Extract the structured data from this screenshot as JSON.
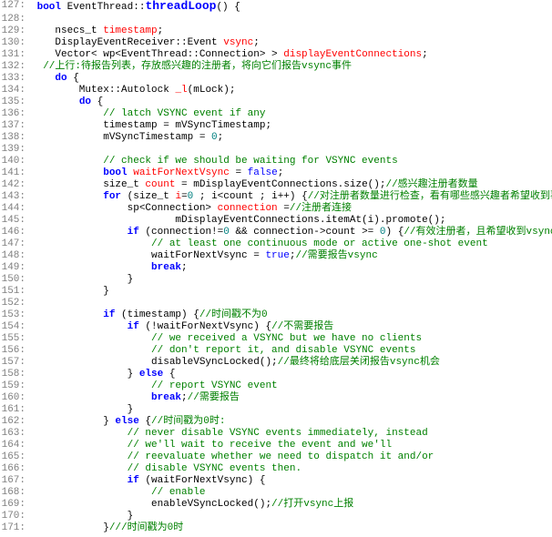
{
  "lines": [
    {
      "n": "127:",
      "segs": [
        {
          "c": "bk",
          "t": " "
        },
        {
          "c": "kw",
          "t": "bool"
        },
        {
          "c": "bk",
          "t": " EventThread::"
        },
        {
          "c": "bl big",
          "t": "threadLoop"
        },
        {
          "c": "bk",
          "t": "() {"
        }
      ]
    },
    {
      "n": "128:",
      "segs": []
    },
    {
      "n": "129:",
      "segs": [
        {
          "c": "bk",
          "t": "    nsecs_t "
        },
        {
          "c": "red",
          "t": "timestamp"
        },
        {
          "c": "bk",
          "t": ";"
        }
      ]
    },
    {
      "n": "130:",
      "segs": [
        {
          "c": "bk",
          "t": "    DisplayEventReceiver::Event "
        },
        {
          "c": "red",
          "t": "vsync"
        },
        {
          "c": "bk",
          "t": ";"
        }
      ]
    },
    {
      "n": "131:",
      "segs": [
        {
          "c": "bk",
          "t": "    Vector< wp<EventThread::Connection> > "
        },
        {
          "c": "red",
          "t": "displayEventConnections"
        },
        {
          "c": "bk",
          "t": ";"
        }
      ]
    },
    {
      "n": "132:",
      "segs": [
        {
          "c": "gr",
          "t": "  //上行:待报告列表，存放感兴趣的注册者，将向它们报告vsync事件"
        }
      ]
    },
    {
      "n": "133:",
      "segs": [
        {
          "c": "bk",
          "t": "    "
        },
        {
          "c": "kw",
          "t": "do"
        },
        {
          "c": "bk",
          "t": " {"
        }
      ]
    },
    {
      "n": "134:",
      "segs": [
        {
          "c": "bk",
          "t": "        Mutex::Autolock "
        },
        {
          "c": "red",
          "t": "_l"
        },
        {
          "c": "bk",
          "t": "(mLock);"
        }
      ]
    },
    {
      "n": "135:",
      "segs": [
        {
          "c": "bk",
          "t": "        "
        },
        {
          "c": "kw",
          "t": "do"
        },
        {
          "c": "bk",
          "t": " {"
        }
      ]
    },
    {
      "n": "136:",
      "segs": [
        {
          "c": "gr",
          "t": "            // latch VSYNC event if any"
        }
      ]
    },
    {
      "n": "137:",
      "segs": [
        {
          "c": "bk",
          "t": "            timestamp = mVSyncTimestamp;"
        }
      ]
    },
    {
      "n": "138:",
      "segs": [
        {
          "c": "bk",
          "t": "            mVSyncTimestamp = "
        },
        {
          "c": "cm",
          "t": "0"
        },
        {
          "c": "bk",
          "t": ";"
        }
      ]
    },
    {
      "n": "139:",
      "segs": []
    },
    {
      "n": "140:",
      "segs": [
        {
          "c": "gr",
          "t": "            // check if we should be waiting for VSYNC events"
        }
      ]
    },
    {
      "n": "141:",
      "segs": [
        {
          "c": "bk",
          "t": "            "
        },
        {
          "c": "kw",
          "t": "bool"
        },
        {
          "c": "bk",
          "t": " "
        },
        {
          "c": "red",
          "t": "waitForNextVsync"
        },
        {
          "c": "bk",
          "t": " = "
        },
        {
          "c": "bl",
          "t": "false"
        },
        {
          "c": "bk",
          "t": ";"
        }
      ]
    },
    {
      "n": "142:",
      "segs": [
        {
          "c": "bk",
          "t": "            size_t "
        },
        {
          "c": "red",
          "t": "count"
        },
        {
          "c": "bk",
          "t": " = mDisplayEventConnections.size();"
        },
        {
          "c": "gr",
          "t": "//感兴趣注册者数量"
        }
      ]
    },
    {
      "n": "143:",
      "segs": [
        {
          "c": "bk",
          "t": "            "
        },
        {
          "c": "kw",
          "t": "for"
        },
        {
          "c": "bk",
          "t": " (size_t "
        },
        {
          "c": "red",
          "t": "i"
        },
        {
          "c": "bk",
          "t": "="
        },
        {
          "c": "cm",
          "t": "0"
        },
        {
          "c": "bk",
          "t": " ; i<count ; i++) {"
        },
        {
          "c": "gr",
          "t": "//对注册者数量进行检查，看有哪些感兴趣者希望收到事件"
        }
      ]
    },
    {
      "n": "144:",
      "segs": [
        {
          "c": "bk",
          "t": "                sp<Connection> "
        },
        {
          "c": "red",
          "t": "connection"
        },
        {
          "c": "bk",
          "t": " ="
        },
        {
          "c": "gr",
          "t": "//注册者连接"
        }
      ]
    },
    {
      "n": "145:",
      "segs": [
        {
          "c": "bk",
          "t": "                        mDisplayEventConnections.itemAt(i).promote();"
        }
      ]
    },
    {
      "n": "146:",
      "segs": [
        {
          "c": "bk",
          "t": "                "
        },
        {
          "c": "kw",
          "t": "if"
        },
        {
          "c": "bk",
          "t": " (connection!="
        },
        {
          "c": "cm",
          "t": "0"
        },
        {
          "c": "bk",
          "t": " && connection->count >= "
        },
        {
          "c": "cm",
          "t": "0"
        },
        {
          "c": "bk",
          "t": ") {"
        },
        {
          "c": "gr",
          "t": "//有效注册者，且希望收到vsync事件报告"
        }
      ]
    },
    {
      "n": "147:",
      "segs": [
        {
          "c": "gr",
          "t": "                    // at least one continuous mode or active one-shot event"
        }
      ]
    },
    {
      "n": "148:",
      "segs": [
        {
          "c": "bk",
          "t": "                    waitForNextVsync = "
        },
        {
          "c": "bl",
          "t": "true"
        },
        {
          "c": "bk",
          "t": ";"
        },
        {
          "c": "gr",
          "t": "//需要报告vsync"
        }
      ]
    },
    {
      "n": "149:",
      "segs": [
        {
          "c": "bk",
          "t": "                    "
        },
        {
          "c": "kw",
          "t": "break"
        },
        {
          "c": "bk",
          "t": ";"
        }
      ]
    },
    {
      "n": "150:",
      "segs": [
        {
          "c": "bk",
          "t": "                }"
        }
      ]
    },
    {
      "n": "151:",
      "segs": [
        {
          "c": "bk",
          "t": "            }"
        }
      ]
    },
    {
      "n": "152:",
      "segs": []
    },
    {
      "n": "153:",
      "segs": [
        {
          "c": "bk",
          "t": "            "
        },
        {
          "c": "kw",
          "t": "if"
        },
        {
          "c": "bk",
          "t": " (timestamp) {"
        },
        {
          "c": "gr",
          "t": "//时间戳不为0"
        }
      ]
    },
    {
      "n": "154:",
      "segs": [
        {
          "c": "bk",
          "t": "                "
        },
        {
          "c": "kw",
          "t": "if"
        },
        {
          "c": "bk",
          "t": " (!waitForNextVsync) {"
        },
        {
          "c": "gr",
          "t": "//不需要报告"
        }
      ]
    },
    {
      "n": "155:",
      "segs": [
        {
          "c": "gr",
          "t": "                    // we received a VSYNC but we have no clients"
        }
      ]
    },
    {
      "n": "156:",
      "segs": [
        {
          "c": "gr",
          "t": "                    // don't report it, and disable VSYNC events"
        }
      ]
    },
    {
      "n": "157:",
      "segs": [
        {
          "c": "bk",
          "t": "                    disableVSyncLocked();"
        },
        {
          "c": "gr",
          "t": "//最终将给底层关闭报告vsync机会"
        }
      ]
    },
    {
      "n": "158:",
      "segs": [
        {
          "c": "bk",
          "t": "                } "
        },
        {
          "c": "kw",
          "t": "else"
        },
        {
          "c": "bk",
          "t": " {"
        }
      ]
    },
    {
      "n": "159:",
      "segs": [
        {
          "c": "gr",
          "t": "                    // report VSYNC event"
        }
      ]
    },
    {
      "n": "160:",
      "segs": [
        {
          "c": "bk",
          "t": "                    "
        },
        {
          "c": "kw",
          "t": "break"
        },
        {
          "c": "bk",
          "t": ";"
        },
        {
          "c": "gr",
          "t": "//需要报告"
        }
      ]
    },
    {
      "n": "161:",
      "segs": [
        {
          "c": "bk",
          "t": "                }"
        }
      ]
    },
    {
      "n": "162:",
      "segs": [
        {
          "c": "bk",
          "t": "            } "
        },
        {
          "c": "kw",
          "t": "else"
        },
        {
          "c": "bk",
          "t": " {"
        },
        {
          "c": "gr",
          "t": "//时间戳为0时:"
        }
      ]
    },
    {
      "n": "163:",
      "segs": [
        {
          "c": "gr",
          "t": "                // never disable VSYNC events immediately, instead"
        }
      ]
    },
    {
      "n": "164:",
      "segs": [
        {
          "c": "gr",
          "t": "                // we'll wait to receive the event and we'll"
        }
      ]
    },
    {
      "n": "165:",
      "segs": [
        {
          "c": "gr",
          "t": "                // reevaluate whether we need to dispatch it and/or"
        }
      ]
    },
    {
      "n": "166:",
      "segs": [
        {
          "c": "gr",
          "t": "                // disable VSYNC events then."
        }
      ]
    },
    {
      "n": "167:",
      "segs": [
        {
          "c": "bk",
          "t": "                "
        },
        {
          "c": "kw",
          "t": "if"
        },
        {
          "c": "bk",
          "t": " (waitForNextVsync) {"
        }
      ]
    },
    {
      "n": "168:",
      "segs": [
        {
          "c": "gr",
          "t": "                    // enable"
        }
      ]
    },
    {
      "n": "169:",
      "segs": [
        {
          "c": "bk",
          "t": "                    enableVSyncLocked();"
        },
        {
          "c": "gr",
          "t": "//打开vsync上报"
        }
      ]
    },
    {
      "n": "170:",
      "segs": [
        {
          "c": "bk",
          "t": "                }"
        }
      ]
    },
    {
      "n": "171:",
      "segs": [
        {
          "c": "bk",
          "t": "            }"
        },
        {
          "c": "gr",
          "t": "///时间戳为0时"
        }
      ]
    }
  ]
}
